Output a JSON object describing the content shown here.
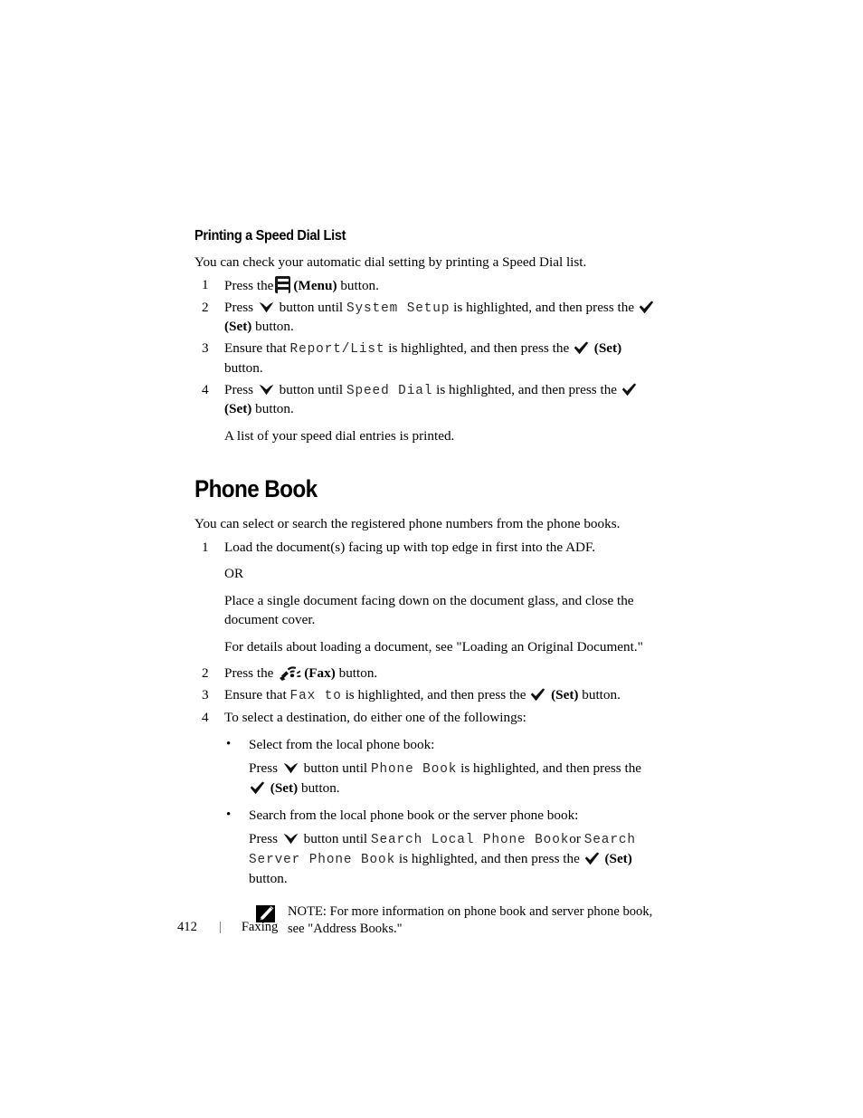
{
  "document": {
    "section_heading": "Printing a Speed Dial List",
    "intro": "You can check your automatic dial setting by printing a Speed Dial list.",
    "speed_dial_steps": [
      {
        "num": "1",
        "pre": "Press the",
        "icon": "menu-icon",
        "bold_label": "(Menu)",
        "post": "button."
      },
      {
        "num": "2",
        "pre": "Press",
        "icon": "down-arrow-icon",
        "mid": "button until",
        "mono": "System Setup",
        "mid2": "is highlighted, and then press the",
        "icon2": "check-icon",
        "bold_label": "(Set)",
        "post": "button."
      },
      {
        "num": "3",
        "pre": "Ensure that",
        "mono": "Report/List",
        "mid2": "is highlighted, and then press the",
        "icon2": "check-icon",
        "bold_label": "(Set)",
        "post": "button."
      },
      {
        "num": "4",
        "pre": "Press",
        "icon": "down-arrow-icon",
        "mid": "button until",
        "mono": "Speed Dial",
        "mid2": "is highlighted, and then press the",
        "icon2": "check-icon",
        "bold_label": "(Set)",
        "post": "button."
      }
    ],
    "speed_dial_result": "A list of your speed dial entries is printed.",
    "main_heading": "Phone Book",
    "main_intro": "You can select or search the registered phone numbers from the phone books.",
    "phone_book": {
      "step1_num": "1",
      "step1_text": "Load the document(s) facing up with top edge in first into the ADF.",
      "step1_or": "OR",
      "step1_alt": "Place a single document facing down on the document glass, and close the document cover.",
      "step1_ref": "For details about loading a document, see \"Loading an Original Document.\"",
      "step2_num": "2",
      "step2_pre": "Press the",
      "step2_icon": "fax-icon",
      "step2_bold": "(Fax)",
      "step2_post": "button.",
      "step3_num": "3",
      "step3_pre": "Ensure that",
      "step3_mono": "Fax to",
      "step3_mid": "is highlighted, and then press the",
      "step3_icon": "check-icon",
      "step3_bold": "(Set)",
      "step3_post": "button.",
      "step4_num": "4",
      "step4_text": "To select a destination, do either one of the followings:",
      "bullet1_label": "Select from the local phone book:",
      "bullet1_pre": "Press",
      "bullet1_icon": "down-arrow-icon",
      "bullet1_mid": "button until",
      "bullet1_mono": "Phone Book",
      "bullet1_mid2": "is highlighted, and then press the",
      "bullet1_icon2": "check-icon",
      "bullet1_bold": "(Set)",
      "bullet1_post": "button.",
      "bullet2_label": "Search from the local phone book or the server phone book:",
      "bullet2_pre": "Press",
      "bullet2_icon": "down-arrow-icon",
      "bullet2_mid": "button until",
      "bullet2_mono": "Search Local Phone Book",
      "bullet2_or": "or",
      "bullet2_mono2": "Search Server Phone Book",
      "bullet2_mid2": "is highlighted, and then press the",
      "bullet2_icon2": "check-icon",
      "bullet2_bold": "(Set)",
      "bullet2_post": "button."
    },
    "note": {
      "icon": "pencil-note-icon",
      "label": "NOTE:",
      "text": "For more information on phone book and server phone book, see \"Address Books.\""
    },
    "footer": {
      "page_number": "412",
      "separator": "|",
      "section": "Faxing"
    }
  }
}
